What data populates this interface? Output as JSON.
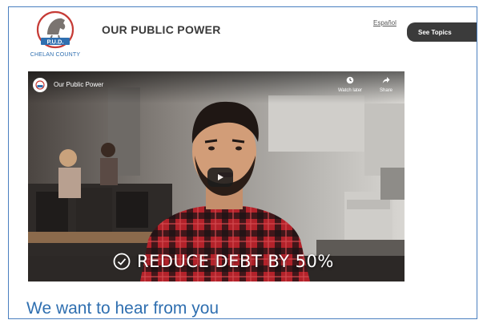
{
  "header": {
    "site_title": "OUR PUBLIC POWER",
    "logo_text": "P.U.D.",
    "logo_subtext": "CHELAN COUNTY",
    "language_link": "Español",
    "see_topics_label": "See Topics"
  },
  "video": {
    "title": "Our Public Power",
    "watch_later_label": "Watch later",
    "share_label": "Share",
    "caption": "REDUCE DEBT BY 50%"
  },
  "main": {
    "heading": "We want to hear from you"
  },
  "colors": {
    "accent_blue": "#2f6fb0",
    "frame_border": "#4a7fc0",
    "button_dark": "#3b3b3b"
  },
  "icons": [
    "pud-logo-icon",
    "play-icon",
    "clock-icon",
    "share-icon",
    "checkmark-icon"
  ]
}
